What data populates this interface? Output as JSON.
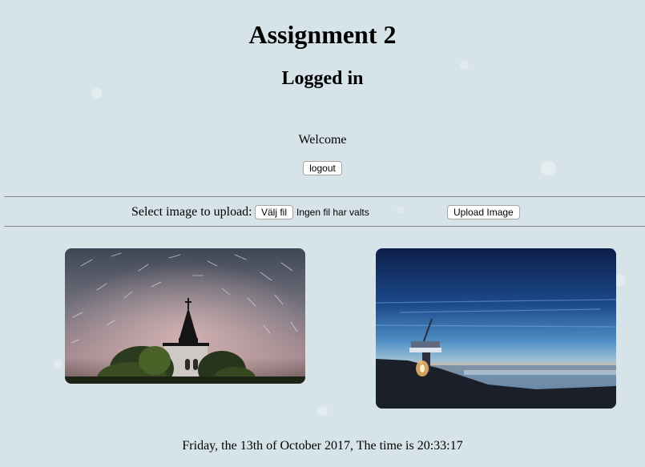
{
  "page": {
    "title": "Assignment 2",
    "subtitle": "Logged in",
    "welcome": "Welcome"
  },
  "actions": {
    "logout_label": "logout"
  },
  "upload": {
    "label": "Select image to upload:",
    "choose_label": "Välj fil",
    "no_file_text": "Ingen fil har valts",
    "submit_label": "Upload Image"
  },
  "gallery": {
    "images": [
      {
        "description": "church-steeple-star-trails"
      },
      {
        "description": "lighthouse-seaside-sunset"
      }
    ]
  },
  "footer": {
    "datetime": "Friday, the 13th of October 2017, The time is 20:33:17"
  },
  "colors": {
    "background": "#d6e3e8",
    "divider": "#8a8a8a"
  }
}
